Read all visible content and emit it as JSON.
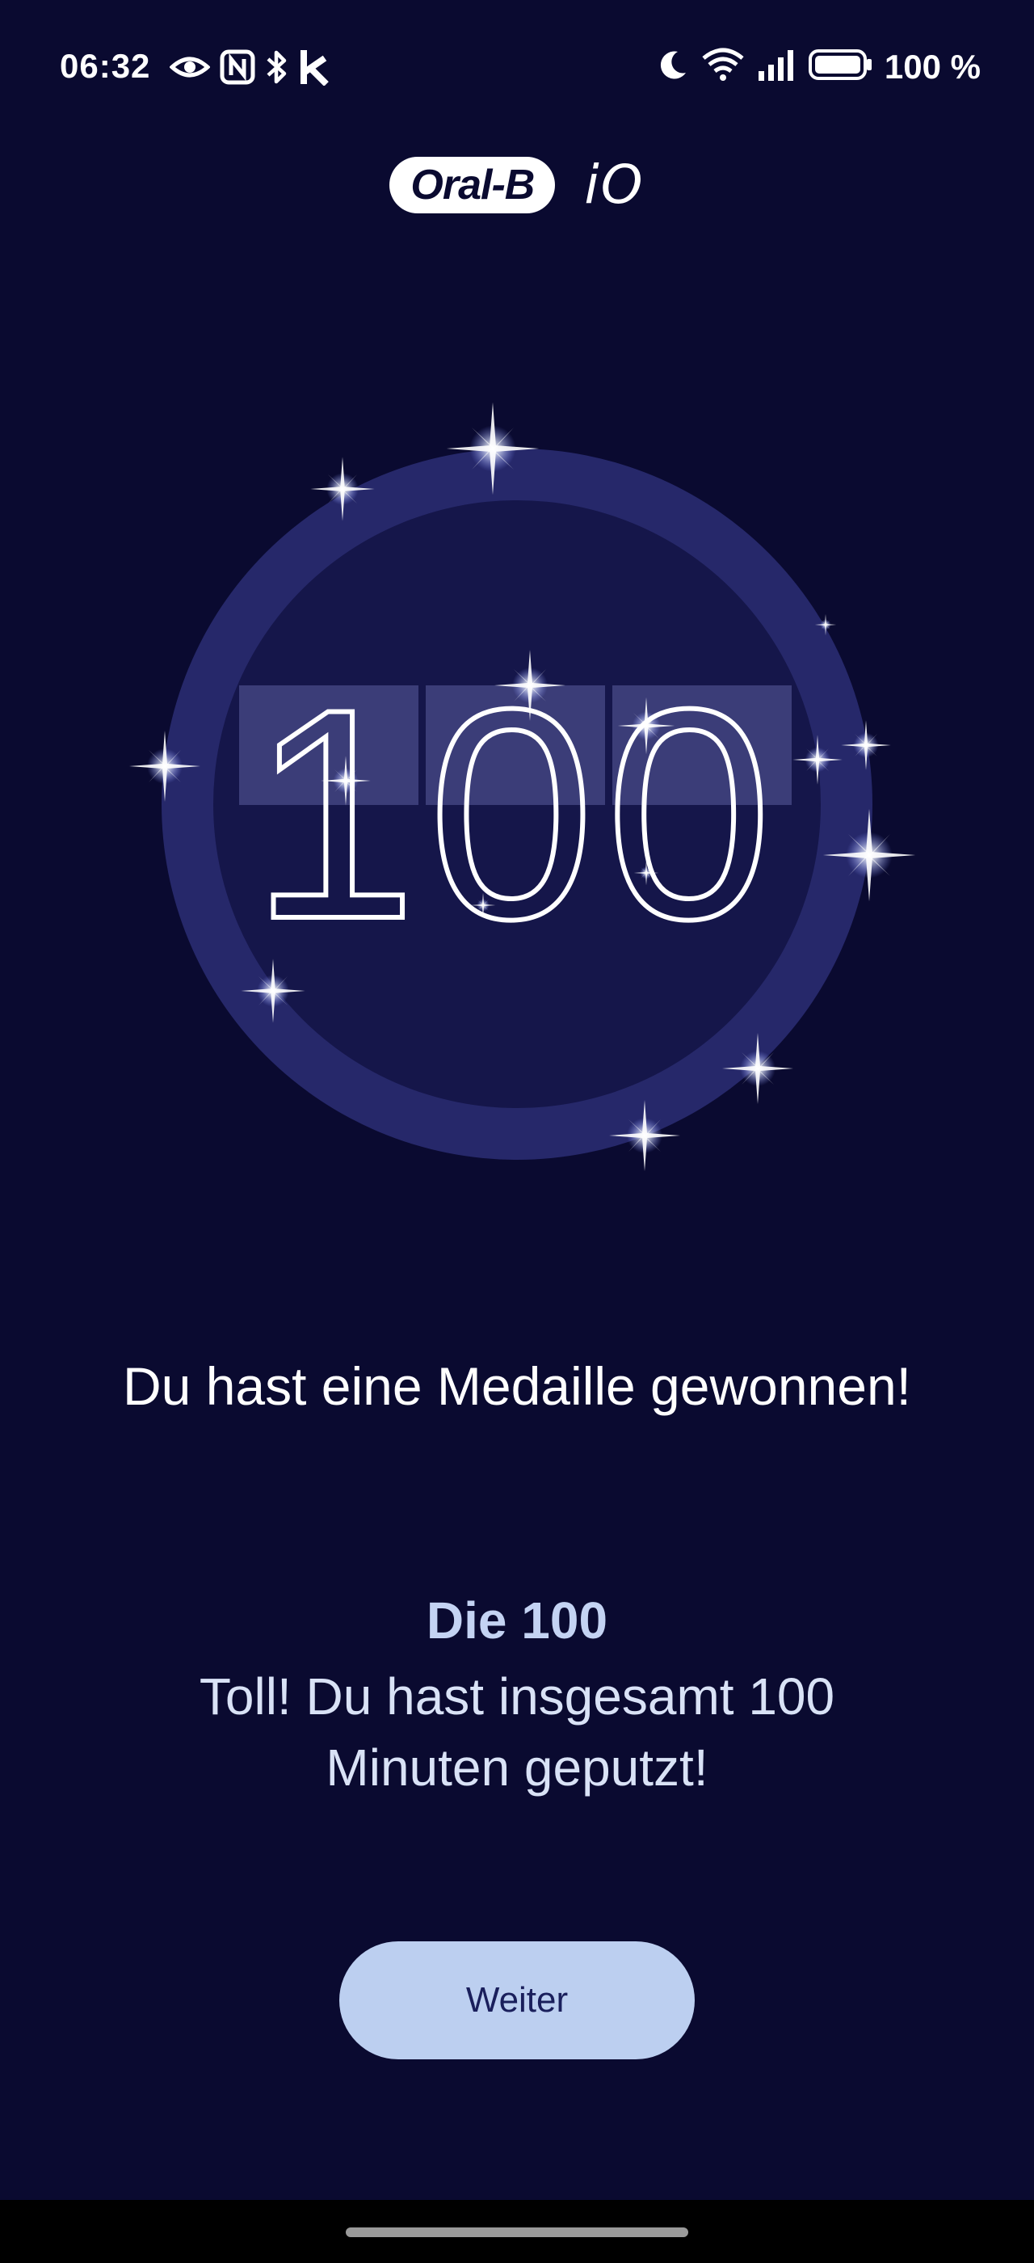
{
  "status_bar": {
    "time": "06:32",
    "battery": "100 %",
    "left_icons": [
      "eye-icon",
      "nfc-icon",
      "bluetooth-icon",
      "k-app-icon"
    ],
    "right_icons": [
      "moon-icon",
      "wifi-icon",
      "signal-icon",
      "battery-icon"
    ]
  },
  "brand": {
    "logo_text": "Oral-B",
    "model": "iO"
  },
  "medal": {
    "number": "100",
    "ring_color": "#26286a",
    "inner_color": "#15164a"
  },
  "message": {
    "headline": "Du hast eine Medaille gewonnen!",
    "medal_name": "Die 100",
    "description": "Toll! Du hast insgesamt 100 Minuten geputzt!"
  },
  "actions": {
    "next_label": "Weiter"
  },
  "colors": {
    "background": "#0a0a30",
    "button": "#bccff0",
    "button_text": "#1a1f5c",
    "accent_text": "#c4d3f3"
  }
}
